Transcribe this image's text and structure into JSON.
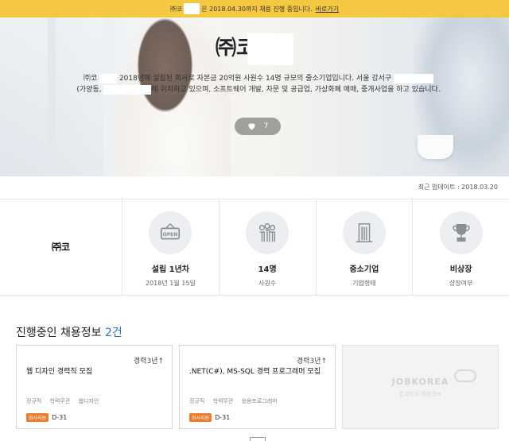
{
  "banner": {
    "prefix": "㈜코",
    "text": "은 2018.04.30까지 채용 진행 중입니다.",
    "link": "바로가기"
  },
  "hero": {
    "title": "㈜코",
    "desc_line1_a": "㈜코",
    "desc_line1_b": "2018년에 설립된 회사로 자본금 20억원 사원수 14명 규모의 중소기업입니다. 서울 강서구",
    "desc_line2_a": "(가양동,",
    "desc_line2_b": "에 위치하고 있으며, 소프트웨어 개발, 자문 및 공급업, 가상화폐 매매, 중개사업을 하고 있습니다.",
    "likes": "7"
  },
  "updated": "최근 업데이트 : 2018.03.20",
  "company_logo_text": "㈜코",
  "stats": [
    {
      "icon": "open-sign-icon",
      "value": "설립 1년차",
      "label": "2018년 1월 15일"
    },
    {
      "icon": "people-icon",
      "value": "14명",
      "label": "사원수"
    },
    {
      "icon": "building-icon",
      "value": "중소기업",
      "label": "기업형태"
    },
    {
      "icon": "trophy-icon",
      "value": "비상장",
      "label": "상장여부"
    }
  ],
  "jobs_section": {
    "title": "진행중인 채용정보",
    "count": "2건"
  },
  "jobs": [
    {
      "career": "경력3년↑",
      "title": "웹 디자인 경력직 모집",
      "tags": [
        "정규직",
        "학력무관",
        "웹디자인"
      ],
      "badge": "회사지원",
      "dday": "D-31"
    },
    {
      "career": "경력3년↑",
      "title": ".NET(C#), MS-SQL 경력 프로그래머 모집",
      "tags": [
        "정규직",
        "학력무관",
        "응용프로그래머"
      ],
      "badge": "회사지원",
      "dday": "D-31"
    }
  ],
  "placeholder": {
    "logo": "JOBKOREA",
    "sub": "잡코리아 채용정보"
  },
  "colors": {
    "banner": "#f5c842",
    "accent": "#2a6fd6",
    "badge": "#f07b2a"
  }
}
